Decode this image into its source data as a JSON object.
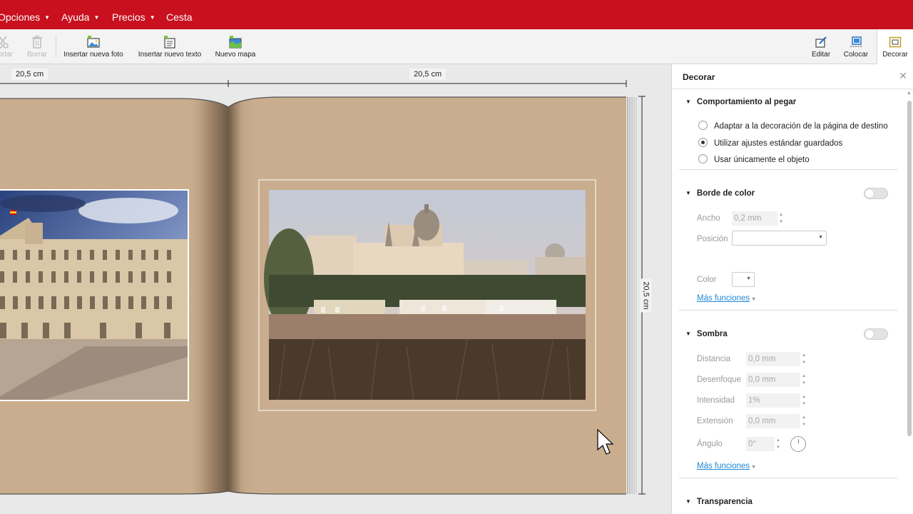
{
  "menubar": {
    "items": [
      {
        "label": "Opciones",
        "has_caret": true
      },
      {
        "label": "Ayuda",
        "has_caret": true
      },
      {
        "label": "Precios",
        "has_caret": true
      },
      {
        "label": "Cesta",
        "has_caret": false
      }
    ]
  },
  "toolbar": {
    "cut_label": "Cortar",
    "delete_label": "Borrar",
    "insert_photo_label": "Insertar nueva foto",
    "insert_text_label": "Insertar nuevo texto",
    "new_map_label": "Nuevo mapa",
    "edit_label": "Editar",
    "place_label": "Colocar",
    "decorate_label": "Decorar"
  },
  "canvas": {
    "left_page_width": "20,5 cm",
    "right_page_width": "20,5 cm",
    "page_height": "20,5 cm",
    "page_color": "#c9ad8e"
  },
  "panel": {
    "title": "Decorar",
    "paste_section": {
      "title": "Comportamiento al pegar",
      "options": [
        {
          "label": "Adaptar a la decoración de la página de destino",
          "selected": false
        },
        {
          "label": "Utilizar ajustes estándar guardados",
          "selected": true
        },
        {
          "label": "Usar únicamente el objeto",
          "selected": false
        }
      ]
    },
    "border_section": {
      "title": "Borde de color",
      "enabled": false,
      "width_label": "Ancho",
      "width_value": "0,2 mm",
      "position_label": "Posición",
      "position_value": "",
      "color_label": "Color",
      "more_label": "Más funciones"
    },
    "shadow_section": {
      "title": "Sombra",
      "enabled": false,
      "distance_label": "Distancia",
      "distance_value": "0,0 mm",
      "blur_label": "Desenfoque",
      "blur_value": "0,0 mm",
      "intensity_label": "Intensidad",
      "intensity_value": "1%",
      "extension_label": "Extensión",
      "extension_value": "0,0 mm",
      "angle_label": "Ángulo",
      "angle_value": "0°",
      "more_label": "Más funciones"
    },
    "transparency_section": {
      "title": "Transparencia"
    }
  },
  "colors": {
    "brand": "#c8101e",
    "link": "#1e88d6"
  }
}
